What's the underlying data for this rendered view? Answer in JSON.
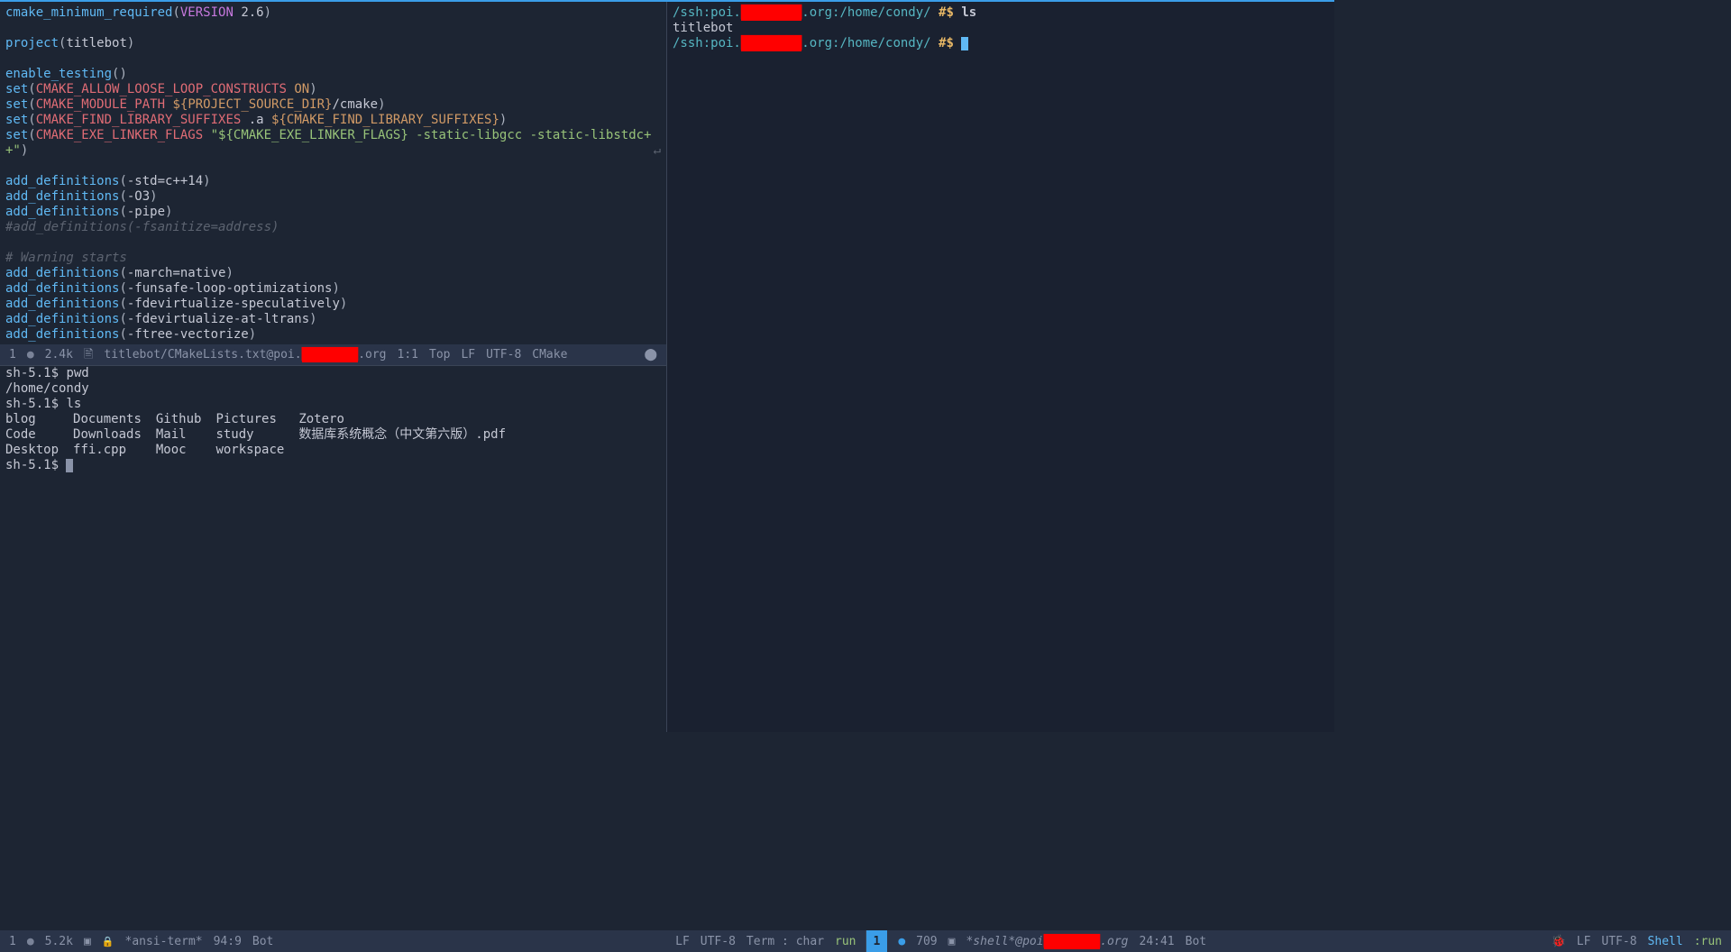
{
  "editor": {
    "l1_fn": "cmake_minimum_required",
    "l1_kw": "VERSION",
    "l1_ver": "2.6",
    "l2_fn": "project",
    "l2_arg": "titlebot",
    "l3_fn": "enable_testing",
    "l4_fn": "set",
    "l4_var": "CMAKE_ALLOW_LOOSE_LOOP_CONSTRUCTS",
    "l4_val": "ON",
    "l5_fn": "set",
    "l5_var": "CMAKE_MODULE_PATH",
    "l5_val": "${PROJECT_SOURCE_DIR}",
    "l5_sfx": "/cmake",
    "l6_fn": "set",
    "l6_var": "CMAKE_FIND_LIBRARY_SUFFIXES",
    "l6_a": ".a",
    "l6_b": "${CMAKE_FIND_LIBRARY_SUFFIXES}",
    "l7_fn": "set",
    "l7_var": "CMAKE_EXE_LINKER_FLAGS",
    "l7_str": "\"${CMAKE_EXE_LINKER_FLAGS} -static-libgcc -static-libstdc+",
    "l7_cont": "+\"",
    "l8_fn": "add_definitions",
    "l8_arg": "-std=c++14",
    "l9_fn": "add_definitions",
    "l9_arg": "-O3",
    "l10_fn": "add_definitions",
    "l10_arg": "-pipe",
    "l11_comment": "#add_definitions(-fsanitize=address)",
    "l12_comment": "# Warning starts",
    "l13_fn": "add_definitions",
    "l13_arg": "-march=native",
    "l14_fn": "add_definitions",
    "l14_arg": "-funsafe-loop-optimizations",
    "l15_fn": "add_definitions",
    "l15_arg": "-fdevirtualize-speculatively",
    "l16_fn": "add_definitions",
    "l16_arg": "-fdevirtualize-at-ltrans",
    "l17_fn": "add_definitions",
    "l17_arg": "-ftree-vectorize",
    "wrap_indicator": "↵"
  },
  "modeline_upper": {
    "num": "1",
    "dot": "●",
    "size": "2.4k",
    "icon": "🖹",
    "path_pre": "titlebot/CMakeLists.txt@poi.",
    "redacted": "████████",
    "path_post": ".org",
    "pos": "1:1",
    "top": "Top",
    "lf": "LF",
    "enc": "UTF-8",
    "mode": "CMake",
    "right_icon": "⬤"
  },
  "term_left": {
    "p1": "sh-5.1$ ",
    "c1": "pwd",
    "o1": "/home/condy",
    "p2": "sh-5.1$ ",
    "c2": "ls",
    "ls_col1": [
      "blog",
      "Code",
      "Desktop"
    ],
    "ls_col2": [
      "Documents",
      "Downloads",
      "ffi.cpp"
    ],
    "ls_col3": [
      "Github",
      "Mail",
      "Mooc"
    ],
    "ls_col4": [
      "Pictures",
      "study",
      "workspace"
    ],
    "ls_col5": [
      "Zotero",
      "数据库系统概念（中文第六版）.pdf",
      ""
    ],
    "p3": "sh-5.1$ "
  },
  "modeline_bl": {
    "num": "1",
    "dot": "●",
    "size": "5.2k",
    "term_icon": "▣",
    "lock_icon": "🔒",
    "buf": "*ansi-term*",
    "pos": "94:9",
    "bot": "Bot",
    "lf": "LF",
    "enc": "UTF-8",
    "mode": "Term : char",
    "run": "run"
  },
  "right_term": {
    "p1_pre": "/ssh:poi.",
    "redacted": "████████",
    "p1_post": ".org:/home/condy/ ",
    "hash": "#$",
    "c1": "ls",
    "o1": "titlebot",
    "p2_pre": "/ssh:poi.",
    "p2_post": ".org:/home/condy/ "
  },
  "modeline_br": {
    "num": "1",
    "dot": "●",
    "size": "709",
    "term_icon": "▣",
    "buf_pre": "*shell*@poi",
    "redacted": "████████",
    "buf_post": ".org",
    "pos": "24:41",
    "bot": "Bot",
    "bug": "🐞",
    "lf": "LF",
    "enc": "UTF-8",
    "mode": "Shell",
    "run": ":run"
  }
}
